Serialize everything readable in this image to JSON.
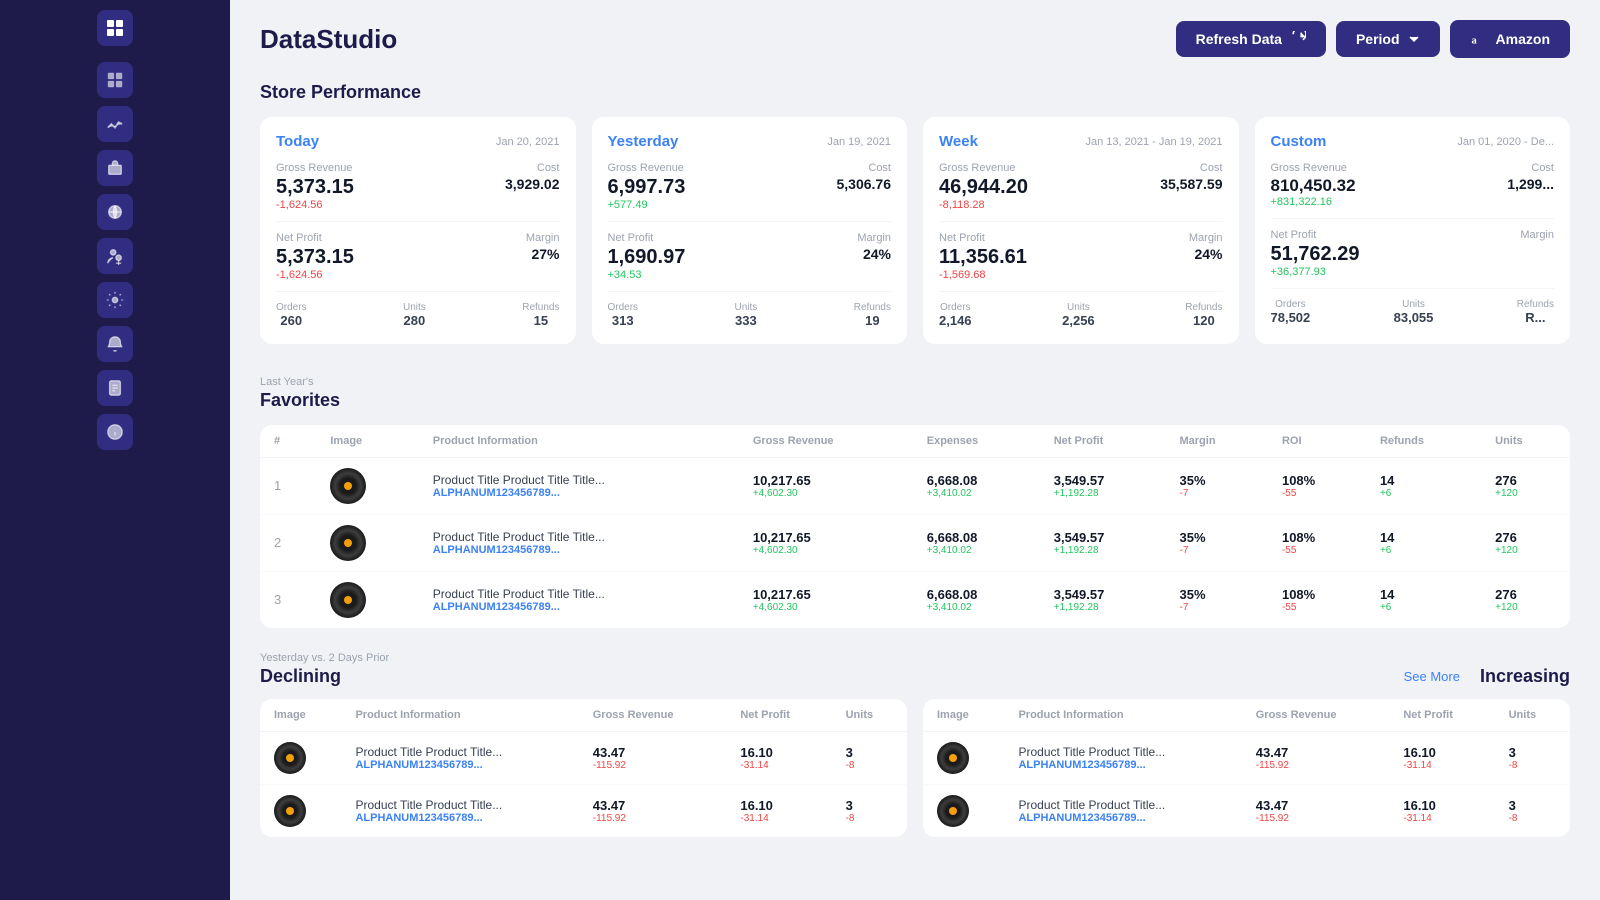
{
  "app": {
    "title": "DataStudio"
  },
  "header": {
    "refresh_label": "Refresh Data",
    "period_label": "Period",
    "amazon_label": "Amazon"
  },
  "store_performance": {
    "section_title": "Store Performance",
    "cards": [
      {
        "id": "today",
        "title": "Today",
        "date": "Jan 20, 2021",
        "gross_revenue_label": "Gross Revenue",
        "gross_revenue": "5,373.15",
        "gross_revenue_change": "-1,624.56",
        "gross_revenue_change_type": "neg",
        "cost_label": "Cost",
        "cost": "3,929.02",
        "net_profit_label": "Net Profit",
        "net_profit": "5,373.15",
        "net_profit_change": "-1,624.56",
        "net_profit_change_type": "neg",
        "margin_label": "Margin",
        "margin": "27%",
        "orders_label": "Orders",
        "orders": "260",
        "units_label": "Units",
        "units": "280",
        "refunds_label": "Refunds",
        "refunds": "15"
      },
      {
        "id": "yesterday",
        "title": "Yesterday",
        "date": "Jan 19, 2021",
        "gross_revenue_label": "Gross Revenue",
        "gross_revenue": "6,997.73",
        "gross_revenue_change": "+577.49",
        "gross_revenue_change_type": "pos",
        "cost_label": "Cost",
        "cost": "5,306.76",
        "net_profit_label": "Net Profit",
        "net_profit": "1,690.97",
        "net_profit_change": "+34.53",
        "net_profit_change_type": "pos",
        "margin_label": "Margin",
        "margin": "24%",
        "orders_label": "Orders",
        "orders": "313",
        "units_label": "Units",
        "units": "333",
        "refunds_label": "Refunds",
        "refunds": "19"
      },
      {
        "id": "week",
        "title": "Week",
        "date": "Jan 13, 2021 - Jan 19, 2021",
        "gross_revenue_label": "Gross Revenue",
        "gross_revenue": "46,944.20",
        "gross_revenue_change": "-8,118.28",
        "gross_revenue_change_type": "neg",
        "cost_label": "Cost",
        "cost": "35,587.59",
        "net_profit_label": "Net Profit",
        "net_profit": "11,356.61",
        "net_profit_change": "-1,569.68",
        "net_profit_change_type": "neg",
        "margin_label": "Margin",
        "margin": "24%",
        "orders_label": "Orders",
        "orders": "2,146",
        "units_label": "Units",
        "units": "2,256",
        "refunds_label": "Refunds",
        "refunds": "120"
      },
      {
        "id": "custom",
        "title": "Custom",
        "date": "Jan 01, 2020 - De...",
        "gross_revenue_label": "Gross Revenue",
        "gross_revenue": "810,450.32",
        "gross_revenue_change": "+831,322.16",
        "gross_revenue_change_type": "pos",
        "cost_label": "Cost",
        "cost": "1,299...",
        "net_profit_label": "Net Profit",
        "net_profit": "51,762.29",
        "net_profit_change": "+36,377.93",
        "net_profit_change_type": "pos",
        "margin_label": "Margin",
        "margin": "",
        "orders_label": "Orders",
        "orders": "78,502",
        "units_label": "Units",
        "units": "83,055",
        "refunds_label": "Refunds",
        "refunds": "R..."
      }
    ]
  },
  "favorites": {
    "subtitle": "Last Year's",
    "section_title": "Favorites",
    "columns": [
      "#",
      "Image",
      "Product Information",
      "Gross Revenue",
      "Expenses",
      "Net Profit",
      "Margin",
      "ROI",
      "Refunds",
      "Units"
    ],
    "rows": [
      {
        "num": "1",
        "product_title": "Product Title Product Title Title...",
        "product_sku": "ALPHANUM123456789...",
        "gross_revenue": "10,217.65",
        "gross_revenue_change": "+4,602.30",
        "expenses": "6,668.08",
        "expenses_change": "+3,410.02",
        "net_profit": "3,549.57",
        "net_profit_change": "+1,192.28",
        "margin": "35%",
        "margin_change": "-7",
        "roi": "108%",
        "roi_change": "-55",
        "refunds": "14",
        "refunds_change": "+6",
        "units": "276",
        "units_change": "+120"
      },
      {
        "num": "2",
        "product_title": "Product Title Product Title Title...",
        "product_sku": "ALPHANUM123456789...",
        "gross_revenue": "10,217.65",
        "gross_revenue_change": "+4,602.30",
        "expenses": "6,668.08",
        "expenses_change": "+3,410.02",
        "net_profit": "3,549.57",
        "net_profit_change": "+1,192.28",
        "margin": "35%",
        "margin_change": "-7",
        "roi": "108%",
        "roi_change": "-55",
        "refunds": "14",
        "refunds_change": "+6",
        "units": "276",
        "units_change": "+120"
      },
      {
        "num": "3",
        "product_title": "Product Title Product Title Title...",
        "product_sku": "ALPHANUM123456789...",
        "gross_revenue": "10,217.65",
        "gross_revenue_change": "+4,602.30",
        "expenses": "6,668.08",
        "expenses_change": "+3,410.02",
        "net_profit": "3,549.57",
        "net_profit_change": "+1,192.28",
        "margin": "35%",
        "margin_change": "-7",
        "roi": "108%",
        "roi_change": "-55",
        "refunds": "14",
        "refunds_change": "+6",
        "units": "276",
        "units_change": "+120"
      }
    ]
  },
  "declining_increasing": {
    "subtitle": "Yesterday vs. 2 Days Prior",
    "declining_title": "Declining",
    "increasing_title": "Increasing",
    "see_more_label": "See More",
    "columns": [
      "Image",
      "Product Information",
      "Gross Revenue",
      "Net Profit",
      "Units"
    ],
    "declining_rows": [
      {
        "product_title": "Product Title Product Title...",
        "product_sku": "ALPHANUM123456789...",
        "gross_revenue": "43.47",
        "gross_revenue_change": "-115.92",
        "net_profit": "16.10",
        "net_profit_change": "-31.14",
        "units": "3",
        "units_change": "-8"
      },
      {
        "product_title": "Product Title Product Title...",
        "product_sku": "ALPHANUM123456789...",
        "gross_revenue": "43.47",
        "gross_revenue_change": "-115.92",
        "net_profit": "16.10",
        "net_profit_change": "-31.14",
        "units": "3",
        "units_change": "-8"
      }
    ],
    "increasing_rows": [
      {
        "product_title": "Product Title Product Title...",
        "product_sku": "ALPHANUM123456789...",
        "gross_revenue": "43.47",
        "gross_revenue_change": "-115.92",
        "net_profit": "16.10",
        "net_profit_change": "-31.14",
        "units": "3",
        "units_change": "-8"
      },
      {
        "product_title": "Product Title Product Title...",
        "product_sku": "ALPHANUM123456789...",
        "gross_revenue": "43.47",
        "gross_revenue_change": "-115.92",
        "net_profit": "16.10",
        "net_profit_change": "-31.14",
        "units": "3",
        "units_change": "-8"
      }
    ]
  },
  "sidebar": {
    "items": [
      {
        "id": "nav-1",
        "icon": "grid"
      },
      {
        "id": "nav-2",
        "icon": "chart"
      },
      {
        "id": "nav-3",
        "icon": "box"
      },
      {
        "id": "nav-4",
        "icon": "tag"
      },
      {
        "id": "nav-5",
        "icon": "users"
      },
      {
        "id": "nav-6",
        "icon": "settings"
      },
      {
        "id": "nav-7",
        "icon": "bell"
      },
      {
        "id": "nav-8",
        "icon": "file"
      },
      {
        "id": "nav-9",
        "icon": "help"
      }
    ]
  }
}
